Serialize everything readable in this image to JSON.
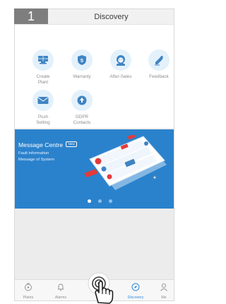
{
  "step": "1",
  "header": {
    "title": "Discovery"
  },
  "tiles": [
    {
      "label": "Create\nPlant",
      "icon": "create-plant-icon"
    },
    {
      "label": "Warranty",
      "icon": "warranty-shield-icon"
    },
    {
      "label": "After-Sales",
      "icon": "after-sales-person-icon"
    },
    {
      "label": "Feedback",
      "icon": "feedback-pen-icon"
    },
    {
      "label": "Push\nSetting",
      "icon": "mail-icon"
    },
    {
      "label": "GDPR\nContacts",
      "icon": "gdpr-upload-icon"
    }
  ],
  "banner": {
    "title": "Message Centre",
    "tag": "New",
    "line1": "Fault information",
    "line2": "Message of System"
  },
  "tabs": [
    {
      "label": "Plants",
      "icon": "plants-icon"
    },
    {
      "label": "Alarms",
      "icon": "bell-icon"
    },
    {
      "label": "",
      "icon": "service-center-icon"
    },
    {
      "label": "Discovery",
      "icon": "compass-icon",
      "active": true
    },
    {
      "label": "Me",
      "icon": "user-icon"
    }
  ],
  "colors": {
    "accent": "#2f8be0",
    "banner": "#2b82cc",
    "tile_bg": "#e3f1fb"
  }
}
